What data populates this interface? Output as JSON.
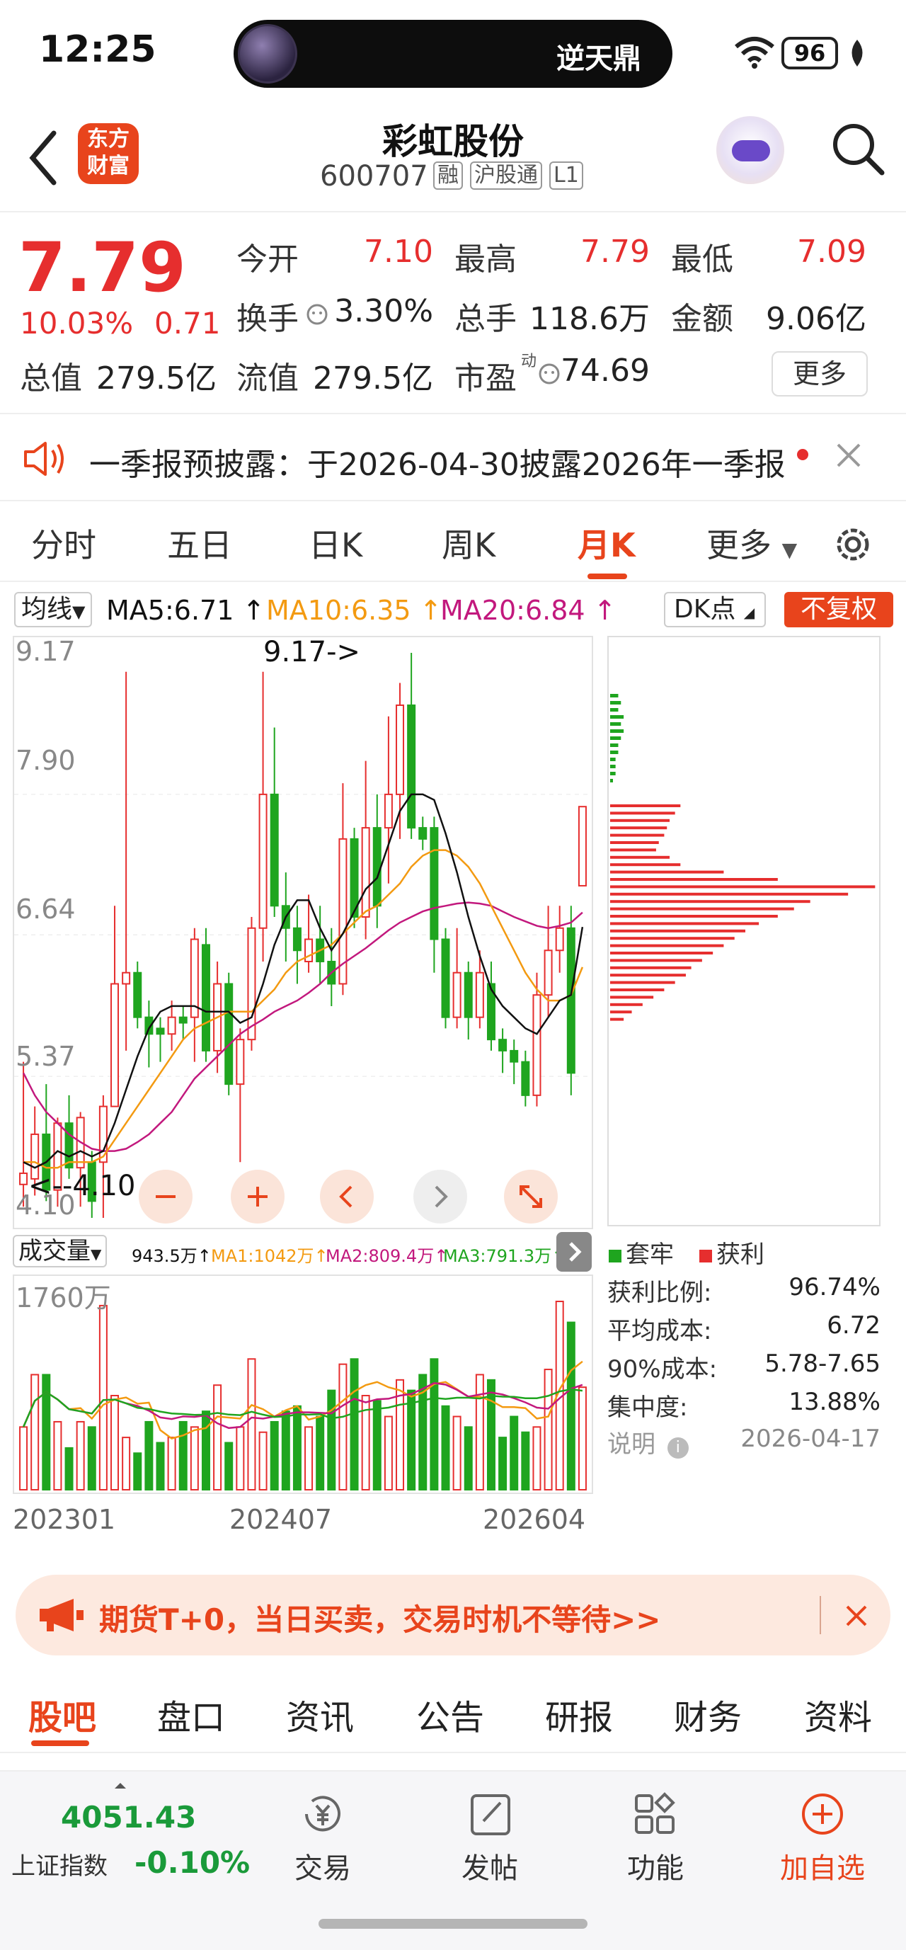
{
  "status_bar": {
    "time": "12:25",
    "island_text": "逆天鼎",
    "battery": "96"
  },
  "header": {
    "title": "彩虹股份",
    "code": "600707",
    "logo_line1": "东方",
    "logo_line2": "财富",
    "tags": [
      "融",
      "沪股通",
      "L1"
    ]
  },
  "quote": {
    "price": "7.79",
    "pct": "10.03%",
    "change": "0.71",
    "open_label": "今开",
    "open": "7.10",
    "high_label": "最高",
    "high": "7.79",
    "low_label": "最低",
    "low": "7.09",
    "turnover_label": "换手",
    "turnover": "3.30%",
    "volume_label": "总手",
    "volume": "118.6万",
    "amount_label": "金额",
    "amount": "9.06亿",
    "mcap_label": "总值",
    "mcap": "279.5亿",
    "float_label": "流值",
    "float": "279.5亿",
    "pe_label": "市盈",
    "pe_sup": "动",
    "pe": "74.69",
    "more": "更多"
  },
  "notice": {
    "text": "一季报预披露：于2026-04-30披露2026年一季报"
  },
  "period_tabs": [
    "分时",
    "五日",
    "日K",
    "周K",
    "月K",
    "更多"
  ],
  "active_period": "月K",
  "ma_bar": {
    "select": "均线",
    "ma5": "MA5:6.71",
    "ma10": "MA10:6.35",
    "ma20": "MA20:6.84",
    "dk": "DK点",
    "fq": "不复权"
  },
  "colors": {
    "up": "#e62e2e",
    "down": "#1fa51f",
    "ma5": "#111111",
    "ma10": "#f39a11",
    "ma20": "#c2187d",
    "accent": "#e8441c"
  },
  "chart_data": {
    "type": "candlestick",
    "period": "month",
    "y_ticks": [
      "9.17",
      "7.90",
      "6.64",
      "5.37",
      "4.10"
    ],
    "ylim": [
      4.1,
      9.17
    ],
    "annotations": {
      "high": "9.17->",
      "low": "<--4.10"
    },
    "candles": [
      [
        4.4,
        4.5,
        4.2,
        5.5
      ],
      [
        4.45,
        4.85,
        4.3,
        5.1
      ],
      [
        4.85,
        4.35,
        4.25,
        5.3
      ],
      [
        4.35,
        4.95,
        4.2,
        5.0
      ],
      [
        4.95,
        4.55,
        4.45,
        5.2
      ],
      [
        4.55,
        5.0,
        4.2,
        5.05
      ],
      [
        4.6,
        4.25,
        4.1,
        4.7
      ],
      [
        4.6,
        5.1,
        4.1,
        5.2
      ],
      [
        5.1,
        6.2,
        5.1,
        6.9
      ],
      [
        6.2,
        6.3,
        5.6,
        9.0
      ],
      [
        6.3,
        5.9,
        5.8,
        6.4
      ],
      [
        5.9,
        5.75,
        5.45,
        6.05
      ],
      [
        5.8,
        5.75,
        5.5,
        5.9
      ],
      [
        5.75,
        5.9,
        5.6,
        6.05
      ],
      [
        5.9,
        5.85,
        5.7,
        6.0
      ],
      [
        5.9,
        6.6,
        5.5,
        6.7
      ],
      [
        6.55,
        5.6,
        5.5,
        6.7
      ],
      [
        5.6,
        6.2,
        5.4,
        6.4
      ],
      [
        6.2,
        5.3,
        5.2,
        6.3
      ],
      [
        5.3,
        5.7,
        4.6,
        5.8
      ],
      [
        5.7,
        6.7,
        5.6,
        6.8
      ],
      [
        6.7,
        7.9,
        6.4,
        9.0
      ],
      [
        7.9,
        6.9,
        6.8,
        8.5
      ],
      [
        6.9,
        6.7,
        6.4,
        7.2
      ],
      [
        6.7,
        6.5,
        6.2,
        6.9
      ],
      [
        6.4,
        6.6,
        6.3,
        7.0
      ],
      [
        6.6,
        6.4,
        6.2,
        6.9
      ],
      [
        6.4,
        6.2,
        6.0,
        6.7
      ],
      [
        6.2,
        7.5,
        6.1,
        8.0
      ],
      [
        7.5,
        6.8,
        6.7,
        7.6
      ],
      [
        6.8,
        7.6,
        6.6,
        8.2
      ],
      [
        7.6,
        6.9,
        6.7,
        7.9
      ],
      [
        7.6,
        7.9,
        7.1,
        8.6
      ],
      [
        7.9,
        8.7,
        7.5,
        8.9
      ],
      [
        8.7,
        7.6,
        7.5,
        9.17
      ],
      [
        7.6,
        7.5,
        7.4,
        7.7
      ],
      [
        7.6,
        6.6,
        6.3,
        7.7
      ],
      [
        6.6,
        5.9,
        5.8,
        6.7
      ],
      [
        5.9,
        6.3,
        5.8,
        6.7
      ],
      [
        6.3,
        5.9,
        5.7,
        6.4
      ],
      [
        5.9,
        6.3,
        5.8,
        6.5
      ],
      [
        6.2,
        5.7,
        5.6,
        6.4
      ],
      [
        5.7,
        5.6,
        5.4,
        5.8
      ],
      [
        5.6,
        5.5,
        5.3,
        5.7
      ],
      [
        5.5,
        5.2,
        5.1,
        5.6
      ],
      [
        5.2,
        6.1,
        5.1,
        6.3
      ],
      [
        6.1,
        6.5,
        5.9,
        6.9
      ],
      [
        6.5,
        6.7,
        6.3,
        6.9
      ],
      [
        6.7,
        5.4,
        5.2,
        6.9
      ],
      [
        7.08,
        7.79,
        7.09,
        7.79
      ]
    ],
    "ma5": [
      4.6,
      4.55,
      4.6,
      4.7,
      4.65,
      4.7,
      4.65,
      4.7,
      4.95,
      5.25,
      5.55,
      5.8,
      5.95,
      6.0,
      6.0,
      6.0,
      5.95,
      5.95,
      5.95,
      5.85,
      5.9,
      6.2,
      6.55,
      6.8,
      6.95,
      6.95,
      6.7,
      6.5,
      6.65,
      6.85,
      7.05,
      7.15,
      7.45,
      7.75,
      7.9,
      7.9,
      7.85,
      7.55,
      7.2,
      6.8,
      6.45,
      6.15,
      6.0,
      5.9,
      5.8,
      5.75,
      5.9,
      6.05,
      6.1,
      6.71
    ],
    "ma10": [
      4.6,
      4.6,
      4.55,
      4.55,
      4.6,
      4.6,
      4.6,
      4.65,
      4.8,
      4.95,
      5.1,
      5.25,
      5.4,
      5.55,
      5.7,
      5.8,
      5.85,
      5.9,
      5.95,
      5.95,
      5.95,
      6.05,
      6.15,
      6.3,
      6.4,
      6.45,
      6.5,
      6.55,
      6.65,
      6.75,
      6.85,
      6.9,
      7.0,
      7.1,
      7.25,
      7.35,
      7.4,
      7.4,
      7.35,
      7.25,
      7.1,
      6.9,
      6.7,
      6.5,
      6.3,
      6.15,
      6.05,
      6.05,
      6.1,
      6.35
    ],
    "ma20": [
      5.4,
      5.2,
      5.05,
      4.95,
      4.85,
      4.78,
      4.72,
      4.7,
      4.7,
      4.72,
      4.78,
      4.85,
      4.95,
      5.05,
      5.2,
      5.35,
      5.45,
      5.55,
      5.65,
      5.75,
      5.82,
      5.88,
      5.95,
      6.0,
      6.05,
      6.12,
      6.2,
      6.3,
      6.38,
      6.45,
      6.52,
      6.6,
      6.68,
      6.75,
      6.8,
      6.85,
      6.88,
      6.9,
      6.92,
      6.93,
      6.92,
      6.9,
      6.85,
      6.8,
      6.76,
      6.72,
      6.7,
      6.72,
      6.75,
      6.84
    ],
    "x_ticks": [
      "202301",
      "202407",
      "202604"
    ],
    "volume": {
      "label": "成交量",
      "current": "943.5万",
      "ma1": "MA1:1042万",
      "ma2": "MA2:809.4万",
      "ma3": "MA3:791.3万",
      "ymax_label": "1760万",
      "values": [
        600,
        1100,
        1100,
        650,
        400,
        650,
        600,
        1760,
        900,
        500,
        350,
        650,
        450,
        500,
        650,
        600,
        750,
        1000,
        450,
        600,
        1250,
        550,
        650,
        750,
        800,
        600,
        700,
        950,
        1200,
        1250,
        900,
        850,
        700,
        1050,
        950,
        1100,
        1250,
        800,
        700,
        600,
        1100,
        1050,
        500,
        700,
        550,
        600,
        1150,
        1800,
        1600,
        980
      ]
    }
  },
  "chips": {
    "legend_trap": "套牢",
    "legend_profit": "获利",
    "stats": [
      {
        "label": "获利比例:",
        "value": "96.74%"
      },
      {
        "label": "平均成本:",
        "value": "6.72"
      },
      {
        "label": "90%成本:",
        "value": "5.78-7.65"
      },
      {
        "label": "集中度:",
        "value": "13.88%"
      }
    ],
    "note_label": "说明",
    "date": "2026-04-17",
    "profit_bars": [
      0.26,
      0.24,
      0.22,
      0.21,
      0.2,
      0.18,
      0.17,
      0.22,
      0.26,
      0.42,
      0.62,
      0.98,
      0.88,
      0.74,
      0.68,
      0.62,
      0.55,
      0.5,
      0.46,
      0.42,
      0.38,
      0.34,
      0.3,
      0.28,
      0.24,
      0.2,
      0.16,
      0.12,
      0.08,
      0.05
    ],
    "trap_bars": [
      0.03,
      0.04,
      0.03,
      0.05,
      0.04,
      0.05,
      0.04,
      0.03,
      0.03,
      0.02,
      0.02,
      0.02,
      0.01
    ]
  },
  "promo": {
    "text": "期货T+0，当日买卖，交易时机不等待>>"
  },
  "bottom_tabs": [
    "股吧",
    "盘口",
    "资讯",
    "公告",
    "研报",
    "财务",
    "资料"
  ],
  "bottom_nav": {
    "index_value": "4051.43",
    "index_name": "上证指数",
    "index_pct": "-0.10%",
    "items": [
      "交易",
      "发帖",
      "功能",
      "加自选"
    ]
  }
}
